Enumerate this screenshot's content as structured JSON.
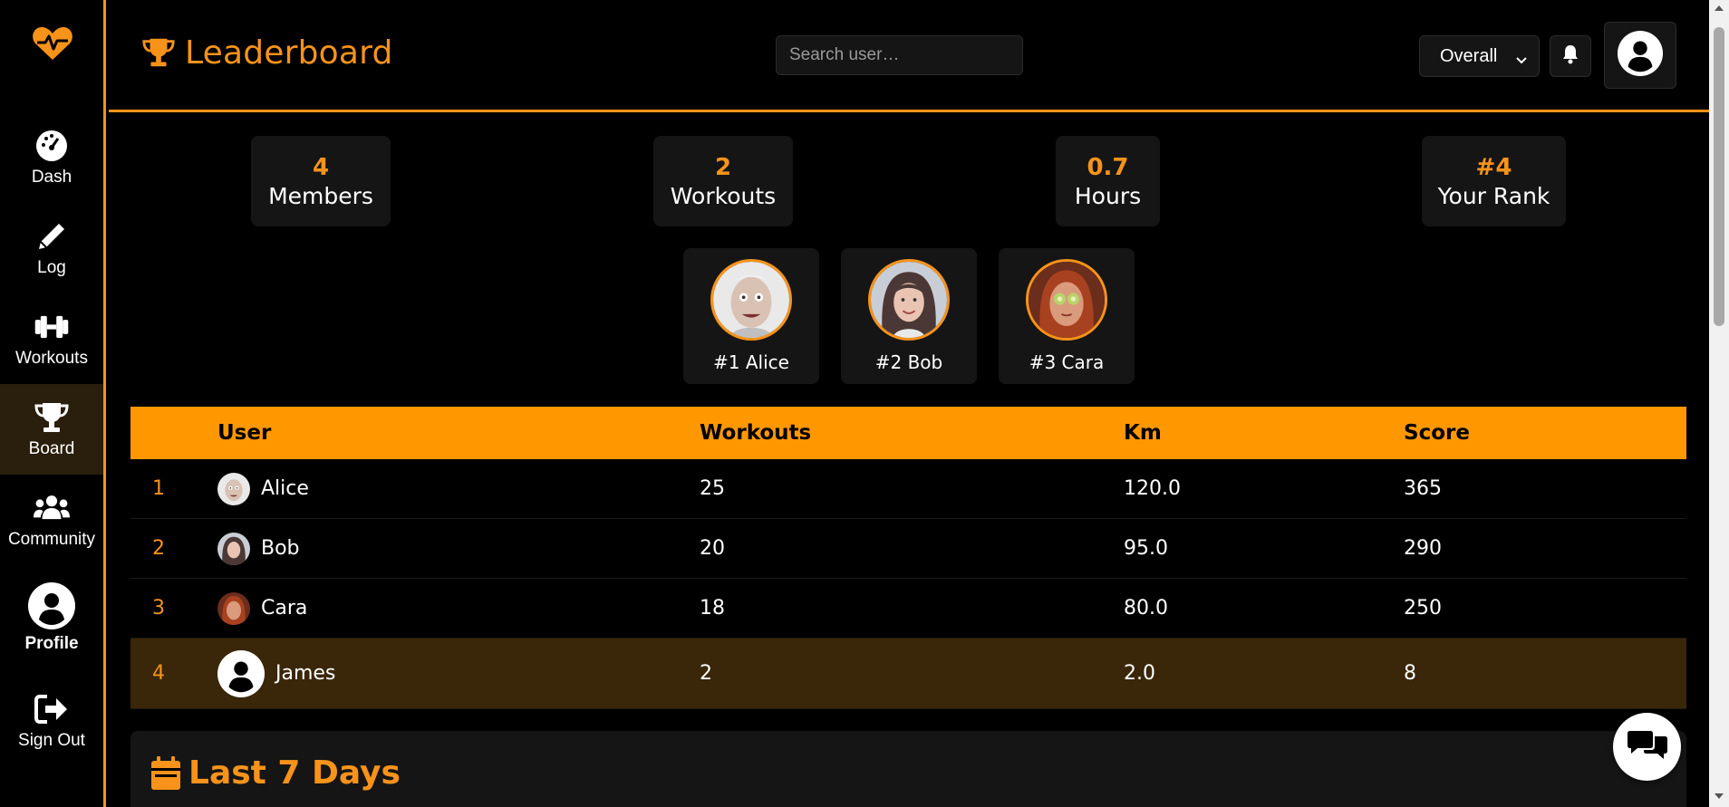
{
  "colors": {
    "accent": "#f7931a",
    "header_row": "#ff9800",
    "highlight_row": "#3a2608",
    "card": "#151515"
  },
  "sidebar": {
    "items": [
      {
        "label": "Dash",
        "icon": "gauge-icon"
      },
      {
        "label": "Log",
        "icon": "pencil-icon"
      },
      {
        "label": "Workouts",
        "icon": "dumbbell-icon"
      },
      {
        "label": "Board",
        "icon": "trophy-icon",
        "active": true
      },
      {
        "label": "Community",
        "icon": "users-icon"
      },
      {
        "label": "Profile",
        "icon": "user-circle-icon"
      },
      {
        "label": "Sign Out",
        "icon": "sign-out-icon"
      }
    ]
  },
  "header": {
    "title": "Leaderboard",
    "search_placeholder": "Search user…",
    "filter_value": "Overall"
  },
  "stats": [
    {
      "value": "4",
      "label": "Members"
    },
    {
      "value": "2",
      "label": "Workouts"
    },
    {
      "value": "0.7",
      "label": "Hours"
    },
    {
      "value": "#4",
      "label": "Your Rank"
    }
  ],
  "podium": [
    {
      "label": "#1 Alice"
    },
    {
      "label": "#2 Bob"
    },
    {
      "label": "#3 Cara"
    }
  ],
  "table": {
    "headers": {
      "user": "User",
      "workouts": "Workouts",
      "km": "Km",
      "score": "Score"
    },
    "rows": [
      {
        "rank": "1",
        "user": "Alice",
        "workouts": "25",
        "km": "120.0",
        "score": "365"
      },
      {
        "rank": "2",
        "user": "Bob",
        "workouts": "20",
        "km": "95.0",
        "score": "290"
      },
      {
        "rank": "3",
        "user": "Cara",
        "workouts": "18",
        "km": "80.0",
        "score": "250"
      },
      {
        "rank": "4",
        "user": "James",
        "workouts": "2",
        "km": "2.0",
        "score": "8"
      }
    ]
  },
  "last7": {
    "title": "Last 7 Days"
  }
}
